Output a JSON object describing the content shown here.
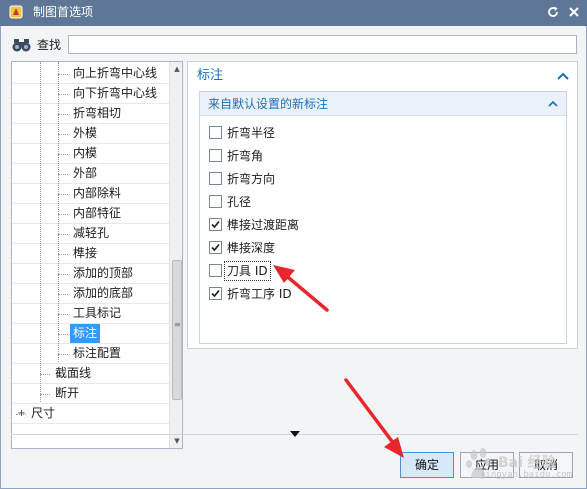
{
  "window": {
    "title": "制图首选项",
    "reset_icon": "reset-icon",
    "close_icon": "close-icon",
    "title_bar_color": "#5e7797"
  },
  "search": {
    "label": "查找",
    "icon": "binoculars-icon",
    "value": "",
    "placeholder": ""
  },
  "tree": {
    "items": [
      {
        "label": "向上折弯中心线",
        "depth": 3,
        "selected": false
      },
      {
        "label": "向下折弯中心线",
        "depth": 3,
        "selected": false
      },
      {
        "label": "折弯相切",
        "depth": 3,
        "selected": false
      },
      {
        "label": "外模",
        "depth": 3,
        "selected": false
      },
      {
        "label": "内模",
        "depth": 3,
        "selected": false
      },
      {
        "label": "外部",
        "depth": 3,
        "selected": false
      },
      {
        "label": "内部除料",
        "depth": 3,
        "selected": false
      },
      {
        "label": "内部特征",
        "depth": 3,
        "selected": false
      },
      {
        "label": "减轻孔",
        "depth": 3,
        "selected": false
      },
      {
        "label": "榫接",
        "depth": 3,
        "selected": false
      },
      {
        "label": "添加的顶部",
        "depth": 3,
        "selected": false
      },
      {
        "label": "添加的底部",
        "depth": 3,
        "selected": false
      },
      {
        "label": "工具标记",
        "depth": 3,
        "selected": false
      },
      {
        "label": "标注",
        "depth": 3,
        "selected": true
      },
      {
        "label": "标注配置",
        "depth": 3,
        "selected": false
      },
      {
        "label": "截面线",
        "depth": 2,
        "selected": false
      },
      {
        "label": "断开",
        "depth": 2,
        "selected": false
      },
      {
        "label": "尺寸",
        "depth": 1,
        "selected": false,
        "expander": "+"
      }
    ]
  },
  "panel": {
    "title": "标注",
    "group": {
      "title": "来自默认设置的新标注",
      "options": [
        {
          "label": "折弯半径",
          "checked": false
        },
        {
          "label": "折弯角",
          "checked": false
        },
        {
          "label": "折弯方向",
          "checked": false
        },
        {
          "label": "孔径",
          "checked": false
        },
        {
          "label": "榫接过渡距离",
          "checked": true
        },
        {
          "label": "榫接深度",
          "checked": true
        },
        {
          "label": "刀具 ID",
          "checked": false,
          "focused": true
        },
        {
          "label": "折弯工序 ID",
          "checked": true
        }
      ]
    }
  },
  "buttons": {
    "ok": "确定",
    "apply": "应用",
    "cancel": "取消"
  },
  "watermark": {
    "text": "Bai 经验",
    "sub": "jingyan.baidu.com"
  },
  "colors": {
    "accent": "#1c6fbd",
    "selection": "#3399ff",
    "annotation_arrow": "#e8262b"
  }
}
